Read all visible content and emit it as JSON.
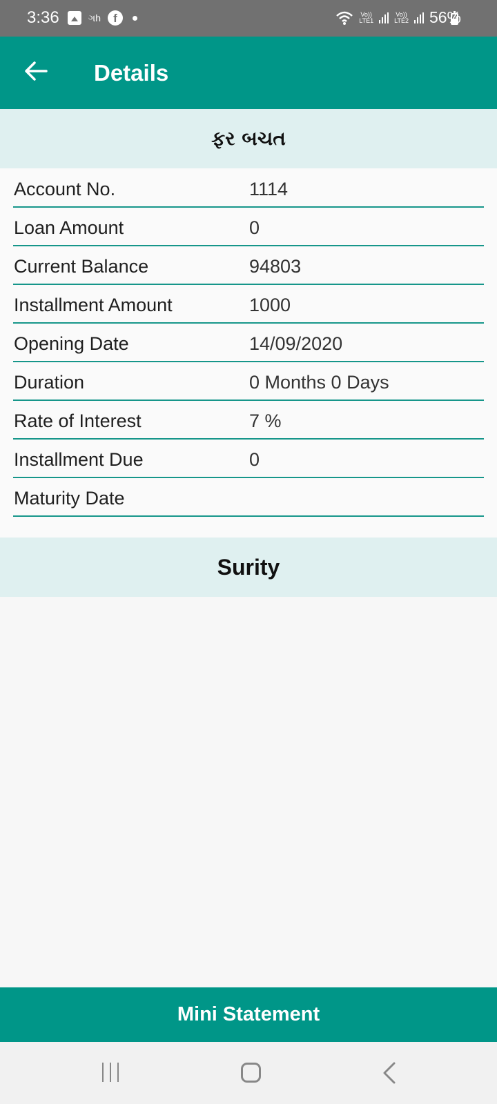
{
  "status_bar": {
    "time": "3:36",
    "gujarati_icon_text": "ગh",
    "volte1": "Vo))",
    "lte1": "LTE1",
    "volte2": "Vo))",
    "lte2": "LTE2",
    "battery": "56%"
  },
  "toolbar": {
    "title": "Details",
    "back_icon": "arrow-left-icon"
  },
  "account_type_header": "ફર બચત",
  "details": [
    {
      "label": "Account No.",
      "value": "1114"
    },
    {
      "label": "Loan Amount",
      "value": "0"
    },
    {
      "label": "Current Balance",
      "value": "94803"
    },
    {
      "label": "Installment Amount",
      "value": "1000"
    },
    {
      "label": "Opening Date",
      "value": "14/09/2020"
    },
    {
      "label": "Duration",
      "value": "0 Months 0 Days"
    },
    {
      "label": "Rate of Interest",
      "value": "7 %"
    },
    {
      "label": "Installment Due",
      "value": "0"
    },
    {
      "label": "Maturity Date",
      "value": ""
    }
  ],
  "surity_header": "Surity",
  "mini_statement_label": "Mini Statement",
  "colors": {
    "primary": "#009688",
    "section_bg": "#dff0f0",
    "divider": "#16968a"
  }
}
